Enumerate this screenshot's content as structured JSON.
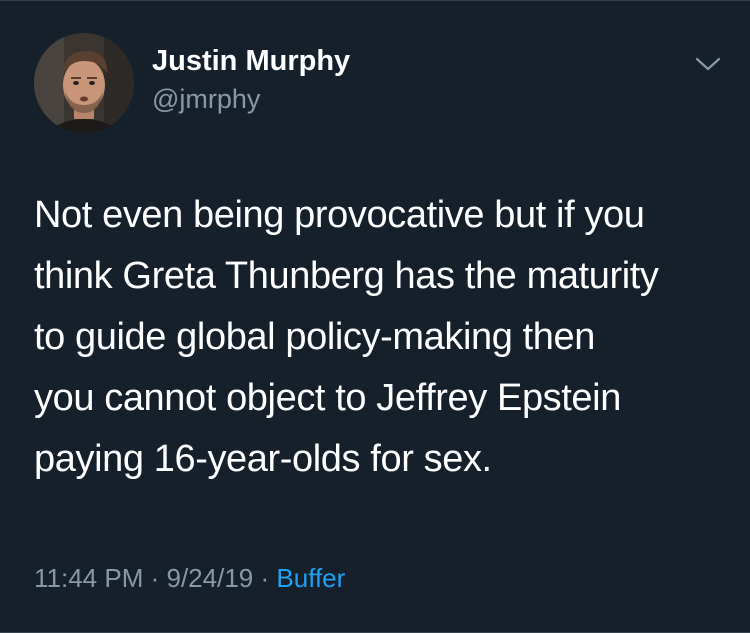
{
  "user": {
    "display_name": "Justin Murphy",
    "handle": "@jmrphy"
  },
  "tweet": {
    "lines": [
      "Not even being provocative but if you",
      "think Greta Thunberg has the maturity",
      "to guide global policy-making then",
      "you cannot object to Jeffrey Epstein",
      "paying 16-year-olds for sex."
    ],
    "time": "11:44 PM",
    "separator": "·",
    "date": "9/24/19",
    "source": "Buffer"
  },
  "icons": {
    "menu": "chevron-down-icon"
  },
  "colors": {
    "background": "#15202b",
    "secondary_text": "#8899a6",
    "link": "#1da1f2"
  }
}
